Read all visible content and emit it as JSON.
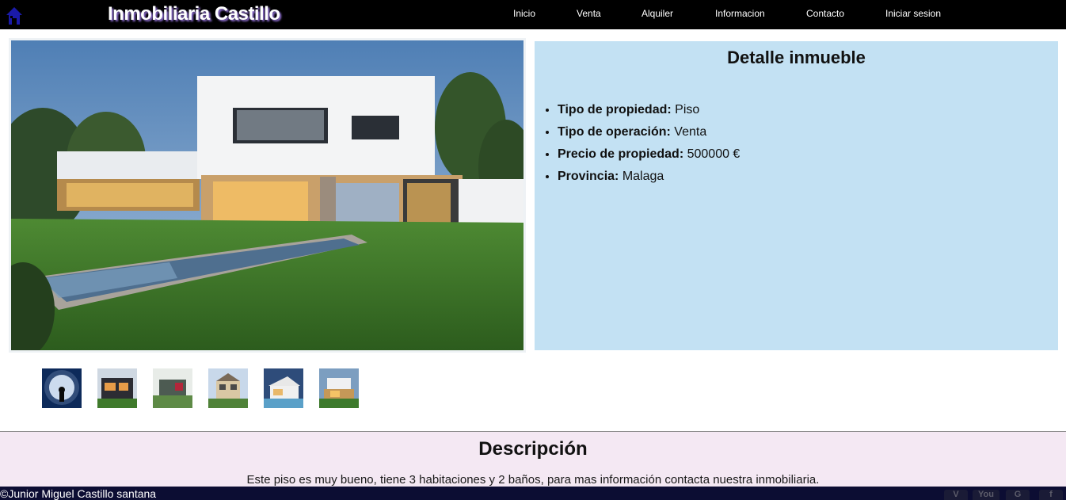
{
  "header": {
    "brand": "Inmobiliaria Castillo",
    "home_icon": "house-icon",
    "nav": [
      {
        "label": "Inicio"
      },
      {
        "label": "Venta"
      },
      {
        "label": "Alquiler"
      },
      {
        "label": "Informacion"
      },
      {
        "label": "Contacto"
      },
      {
        "label": "Iniciar sesion"
      }
    ]
  },
  "detail": {
    "title": "Detalle inmueble",
    "items": [
      {
        "label": "Tipo de propiedad:",
        "value": "Piso"
      },
      {
        "label": "Tipo de operación:",
        "value": "Venta"
      },
      {
        "label": "Precio de propiedad:",
        "value": "500000 €"
      },
      {
        "label": "Provincia:",
        "value": "Malaga"
      }
    ]
  },
  "gallery": {
    "main_photo": "modern-house-with-pool-photo",
    "thumbnails": [
      "moon-silhouette-thumbnail",
      "dark-house-thumbnail",
      "garden-house-thumbnail",
      "townhouse-thumbnail",
      "pool-house-thumbnail",
      "villa-thumbnail"
    ]
  },
  "description": {
    "title": "Descripción",
    "text": "Este piso es muy bueno, tiene 3 habitaciones y 2 baños, para mas información contacta nuestra inmobiliaria."
  },
  "footer": {
    "copyright": "©Junior Miguel Castillo santana",
    "social_icons": [
      "vimeo-icon",
      "youtube-icon",
      "google-plus-icon",
      "facebook-icon"
    ]
  },
  "colors": {
    "navbar": "#000000",
    "brand_shadow": "#8f6fd1",
    "detail_panel": "#c3e1f3",
    "description_bg": "#f4e8f3",
    "footer": "#0c0d33"
  }
}
